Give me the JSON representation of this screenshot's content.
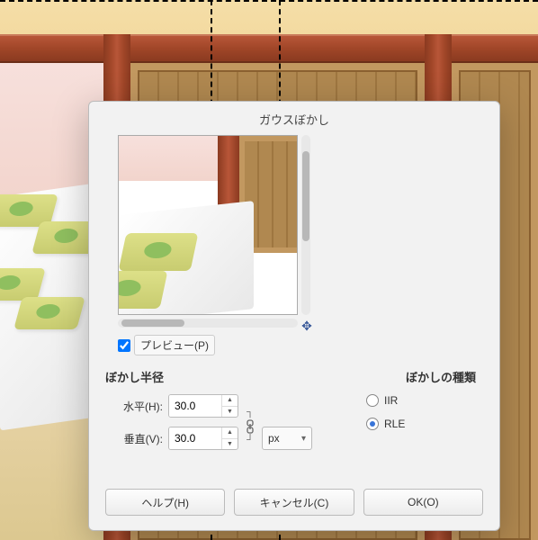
{
  "dialog": {
    "title": "ガウスぼかし",
    "preview_label": "プレビュー(P)",
    "preview_checked": true
  },
  "radius": {
    "section_title": "ぼかし半径",
    "h_label": "水平(H):",
    "v_label": "垂直(V):",
    "h_value": "30.0",
    "v_value": "30.0",
    "unit": "px"
  },
  "blur_type": {
    "section_title": "ぼかしの種類",
    "options": {
      "iir": "IIR",
      "rle": "RLE"
    },
    "selected": "rle"
  },
  "buttons": {
    "help": "ヘルプ(H)",
    "cancel": "キャンセル(C)",
    "ok": "OK(O)"
  }
}
